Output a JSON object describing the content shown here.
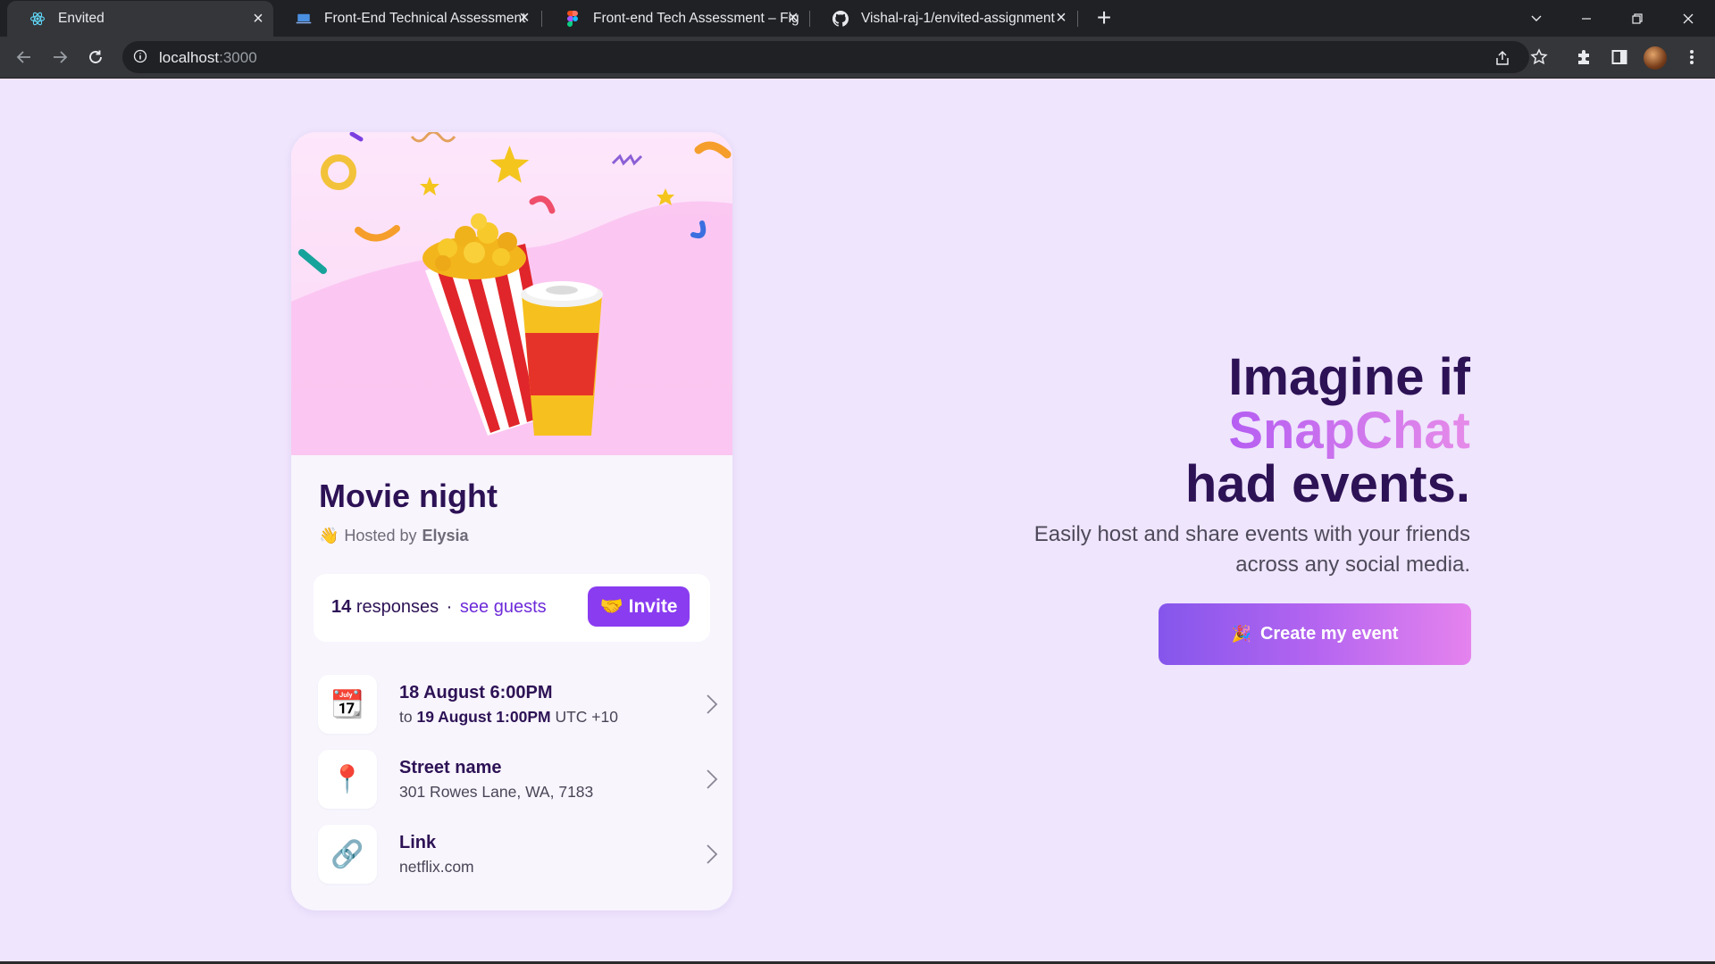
{
  "browser": {
    "tabs": [
      {
        "title": "Envited",
        "active": true
      },
      {
        "title": "Front-End Technical Assessment",
        "active": false
      },
      {
        "title": "Front-end Tech Assessment – Fig",
        "active": false
      },
      {
        "title": "Vishal-raj-1/envited-assignment",
        "active": false
      }
    ],
    "url_host": "localhost",
    "url_port": ":3000"
  },
  "event": {
    "title": "Movie night",
    "hosted_prefix": "Hosted by",
    "host": "Elysia",
    "responses_count": "14",
    "responses_label": "responses",
    "separator": "·",
    "see_guests": "see guests",
    "invite_label": "Invite",
    "details": [
      {
        "icon": "calendar-icon",
        "glyph": "📆",
        "main": "18 August 6:00PM",
        "sub_prefix": "to",
        "sub_bold": "19 August 1:00PM",
        "sub_suffix": "UTC +10"
      },
      {
        "icon": "location-pin-icon",
        "glyph": "📍",
        "main": "Street name",
        "sub": "301 Rowes Lane, WA, 7183"
      },
      {
        "icon": "link-icon",
        "glyph": "🔗",
        "main": "Link",
        "sub": "netflix.com"
      }
    ]
  },
  "hero_copy": {
    "line1": "Imagine if",
    "line2": "SnapChat",
    "line3": "had events.",
    "subtext": "Easily host and share events with your friends across any social media.",
    "cta_label": "Create my event"
  },
  "colors": {
    "page_bg": "#efe5fd",
    "dark_text": "#2d1255",
    "accent": "#8a3cf0",
    "cta_gradient_start": "#8556ec",
    "cta_gradient_end": "#e583ee"
  }
}
